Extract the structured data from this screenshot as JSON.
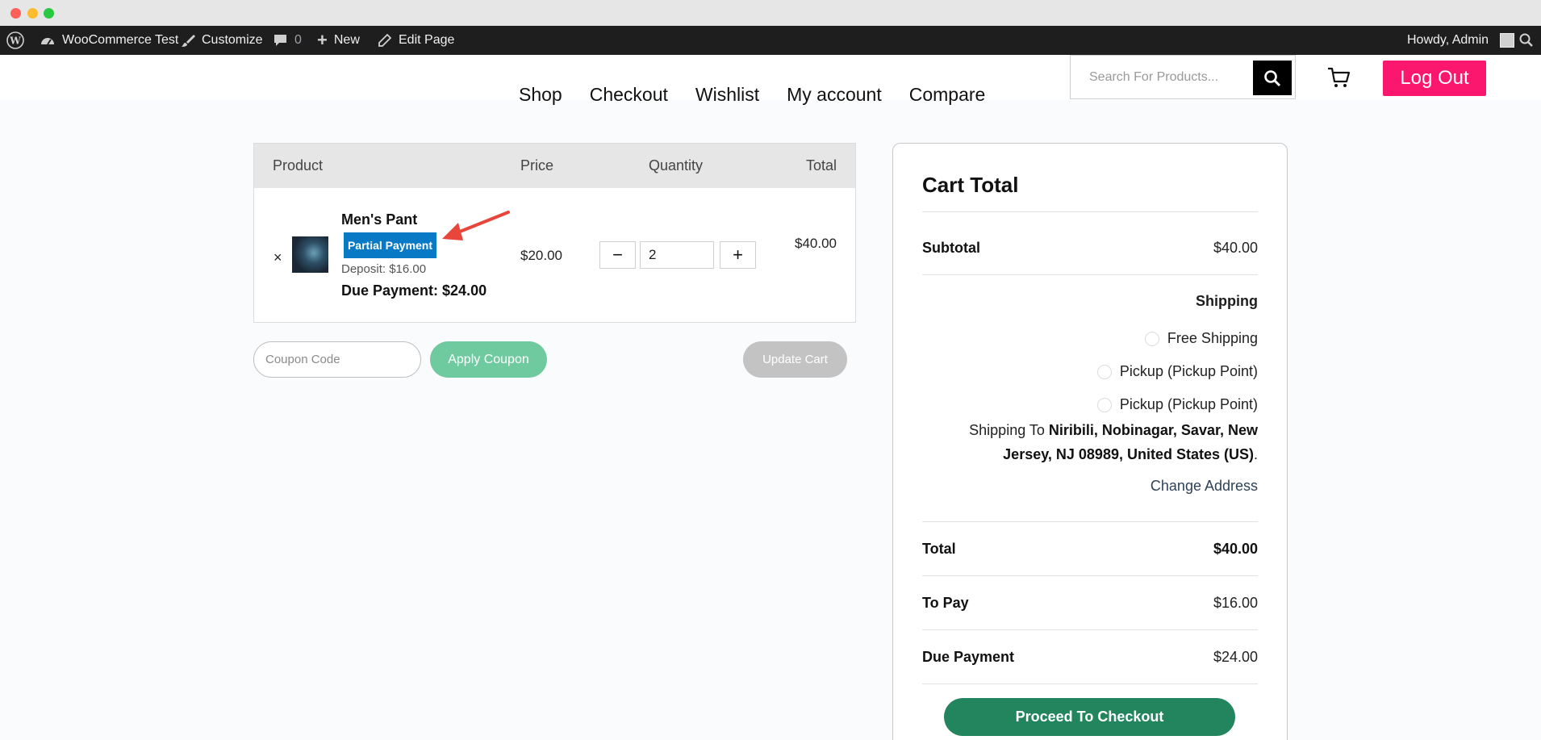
{
  "admin_bar": {
    "site_name": "WooCommerce Test",
    "customize": "Customize",
    "comments_count": "0",
    "new": "New",
    "edit_page": "Edit Page",
    "howdy": "Howdy, Admin"
  },
  "nav": {
    "items": [
      "Shop",
      "Checkout",
      "Wishlist",
      "My account",
      "Compare"
    ]
  },
  "search": {
    "placeholder": "Search For Products..."
  },
  "header": {
    "logout": "Log Out"
  },
  "cart_table": {
    "headers": {
      "product": "Product",
      "price": "Price",
      "quantity": "Quantity",
      "total": "Total"
    },
    "row": {
      "remove": "×",
      "name": "Men's Pant",
      "badge": "Partial Payment",
      "deposit": "Deposit: $16.00",
      "due": "Due Payment: $24.00",
      "price": "$20.00",
      "quantity": "2",
      "total": "$40.00"
    }
  },
  "coupon": {
    "placeholder": "Coupon Code",
    "apply": "Apply Coupon",
    "update": "Update Cart"
  },
  "cart_totals": {
    "title": "Cart Total",
    "subtotal_label": "Subtotal",
    "subtotal": "$40.00",
    "shipping_label": "Shipping",
    "options": [
      "Free Shipping",
      "Pickup (Pickup Point)",
      "Pickup (Pickup Point)"
    ],
    "ship_to_prefix": "Shipping To ",
    "ship_to_address": "Niribili, Nobinagar, Savar, New Jersey, NJ 08989, United States (US)",
    "ship_to_suffix": ".",
    "change_address": "Change Address",
    "total_label": "Total",
    "total": "$40.00",
    "to_pay_label": "To Pay",
    "to_pay": "$16.00",
    "due_label": "Due Payment",
    "due": "$24.00",
    "checkout": "Proceed To Checkout"
  },
  "colors": {
    "accent_pink": "#fb176d",
    "badge_blue": "#0879c5",
    "checkout_green": "#23855d",
    "apply_green": "#6fcb9f",
    "annotation_red": "#e8463a"
  }
}
